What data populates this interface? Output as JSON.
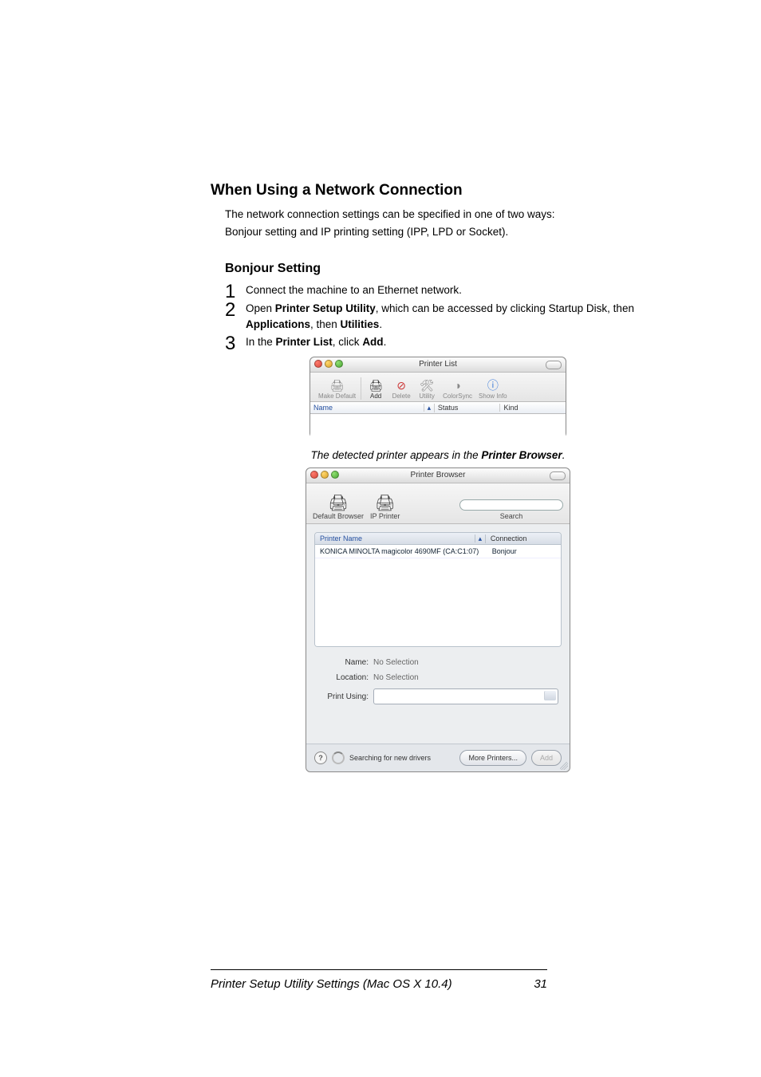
{
  "headings": {
    "h2": "When Using a Network Connection",
    "h3": "Bonjour Setting"
  },
  "intro": {
    "line1": "The network connection settings can be specified in one of two ways:",
    "line2": "Bonjour setting and IP printing setting (IPP, LPD or Socket)."
  },
  "steps": {
    "s1": "Connect the machine to an Ethernet network.",
    "s2_pre": "Open ",
    "s2_b1": "Printer Setup Utility",
    "s2_mid1": ", which can be accessed by clicking Startup Disk, then ",
    "s2_b2": "Applications",
    "s2_mid2": ", then ",
    "s2_b3": "Utilities",
    "s2_end": ".",
    "s3_pre": "In the ",
    "s3_b1": "Printer List",
    "s3_mid": ", click ",
    "s3_b2": "Add",
    "s3_end": "."
  },
  "caption": {
    "pre": "The detected printer appears in the ",
    "bold": "Printer Browser",
    "post": "."
  },
  "shot1": {
    "title": "Printer List",
    "tb": {
      "make_default": "Make Default",
      "add": "Add",
      "delete": "Delete",
      "utility": "Utility",
      "colorsync": "ColorSync",
      "showinfo": "Show Info"
    },
    "cols": {
      "name": "Name",
      "status": "Status",
      "kind": "Kind"
    }
  },
  "shot2": {
    "title": "Printer Browser",
    "tb": {
      "default_browser": "Default Browser",
      "ip_printer": "IP Printer",
      "search": "Search",
      "search_placeholder": "Q-"
    },
    "list": {
      "col_printer": "Printer Name",
      "col_conn": "Connection",
      "row_printer": "KONICA MINOLTA magicolor 4690MF (CA:C1:07)",
      "row_conn": "Bonjour"
    },
    "form": {
      "name_label": "Name:",
      "name_value": "No Selection",
      "location_label": "Location:",
      "location_value": "No Selection",
      "printusing_label": "Print Using:"
    },
    "bottom": {
      "status": "Searching for new drivers",
      "more": "More Printers...",
      "add": "Add"
    }
  },
  "footer": {
    "left": "Printer Setup Utility Settings (Mac OS X 10.4)",
    "page": "31"
  }
}
